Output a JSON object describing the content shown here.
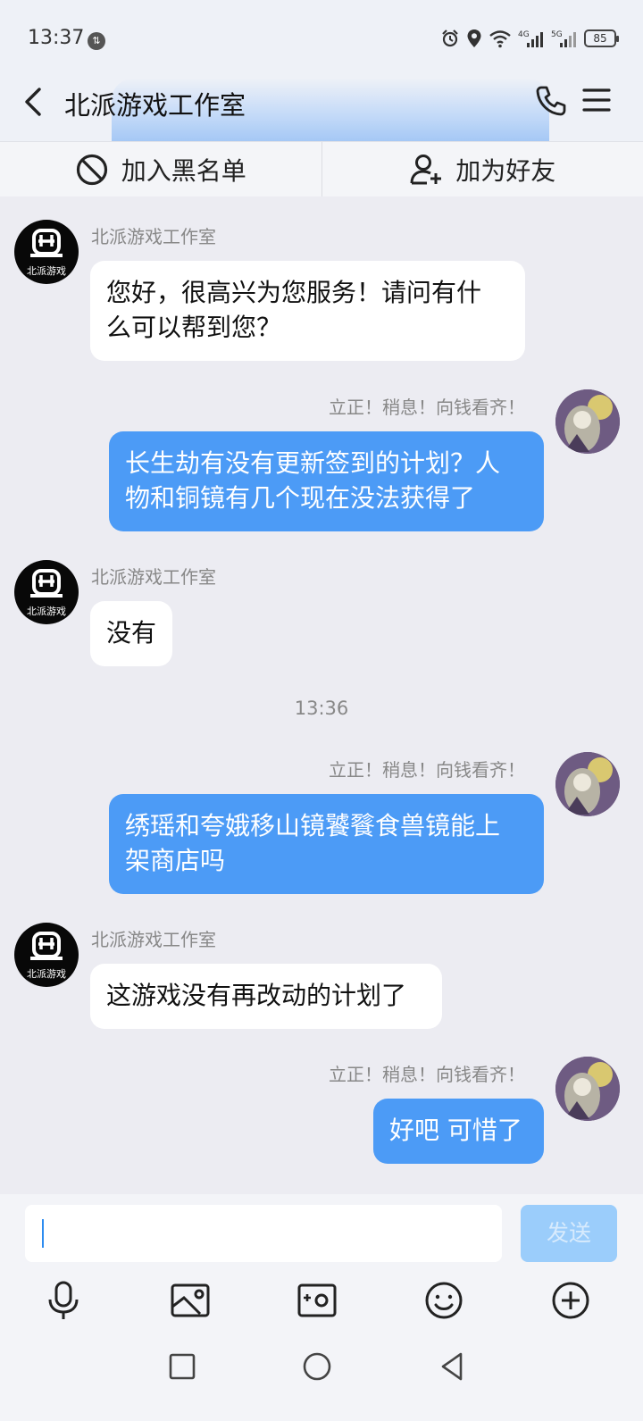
{
  "status_bar": {
    "time": "13:37",
    "battery": "85"
  },
  "header": {
    "title": "北派游戏工作室"
  },
  "actions": {
    "block_label": "加入黑名单",
    "add_friend_label": "加为好友"
  },
  "messages": [
    {
      "from": "studio",
      "sender": "北派游戏工作室",
      "lines": [
        "您好，很高兴为您服务！请问有什",
        "么可以帮到您？"
      ]
    },
    {
      "from": "user",
      "sender": "立正！稍息！向钱看齐！",
      "lines": [
        "长生劫有没有更新签到的计划？人",
        "物和铜镜有几个现在没法获得了"
      ]
    },
    {
      "from": "studio",
      "sender": "北派游戏工作室",
      "lines": [
        "没有"
      ]
    },
    {
      "from": "user",
      "sender": "立正！稍息！向钱看齐！",
      "lines": [
        "绣瑶和夸娥移山镜饕餮食兽镜能上",
        "架商店吗"
      ]
    },
    {
      "from": "studio",
      "sender": "北派游戏工作室",
      "lines": [
        "这游戏没有再改动的计划了"
      ]
    },
    {
      "from": "user",
      "sender": "立正！稍息！向钱看齐！",
      "lines": [
        "好吧 可惜了"
      ]
    }
  ],
  "timestamp": "13:36",
  "avatar_text": "北派游戏",
  "composer": {
    "input_value": "",
    "send_label": "发送"
  },
  "toolbar": [
    "mic-icon",
    "image-icon",
    "camera-icon",
    "emoji-icon",
    "plus-icon"
  ],
  "colors": {
    "outgoing_bubble": "#4c9bf6",
    "incoming_bubble": "#ffffff",
    "background": "#ececf2",
    "send_disabled": "#9bcdfb"
  }
}
